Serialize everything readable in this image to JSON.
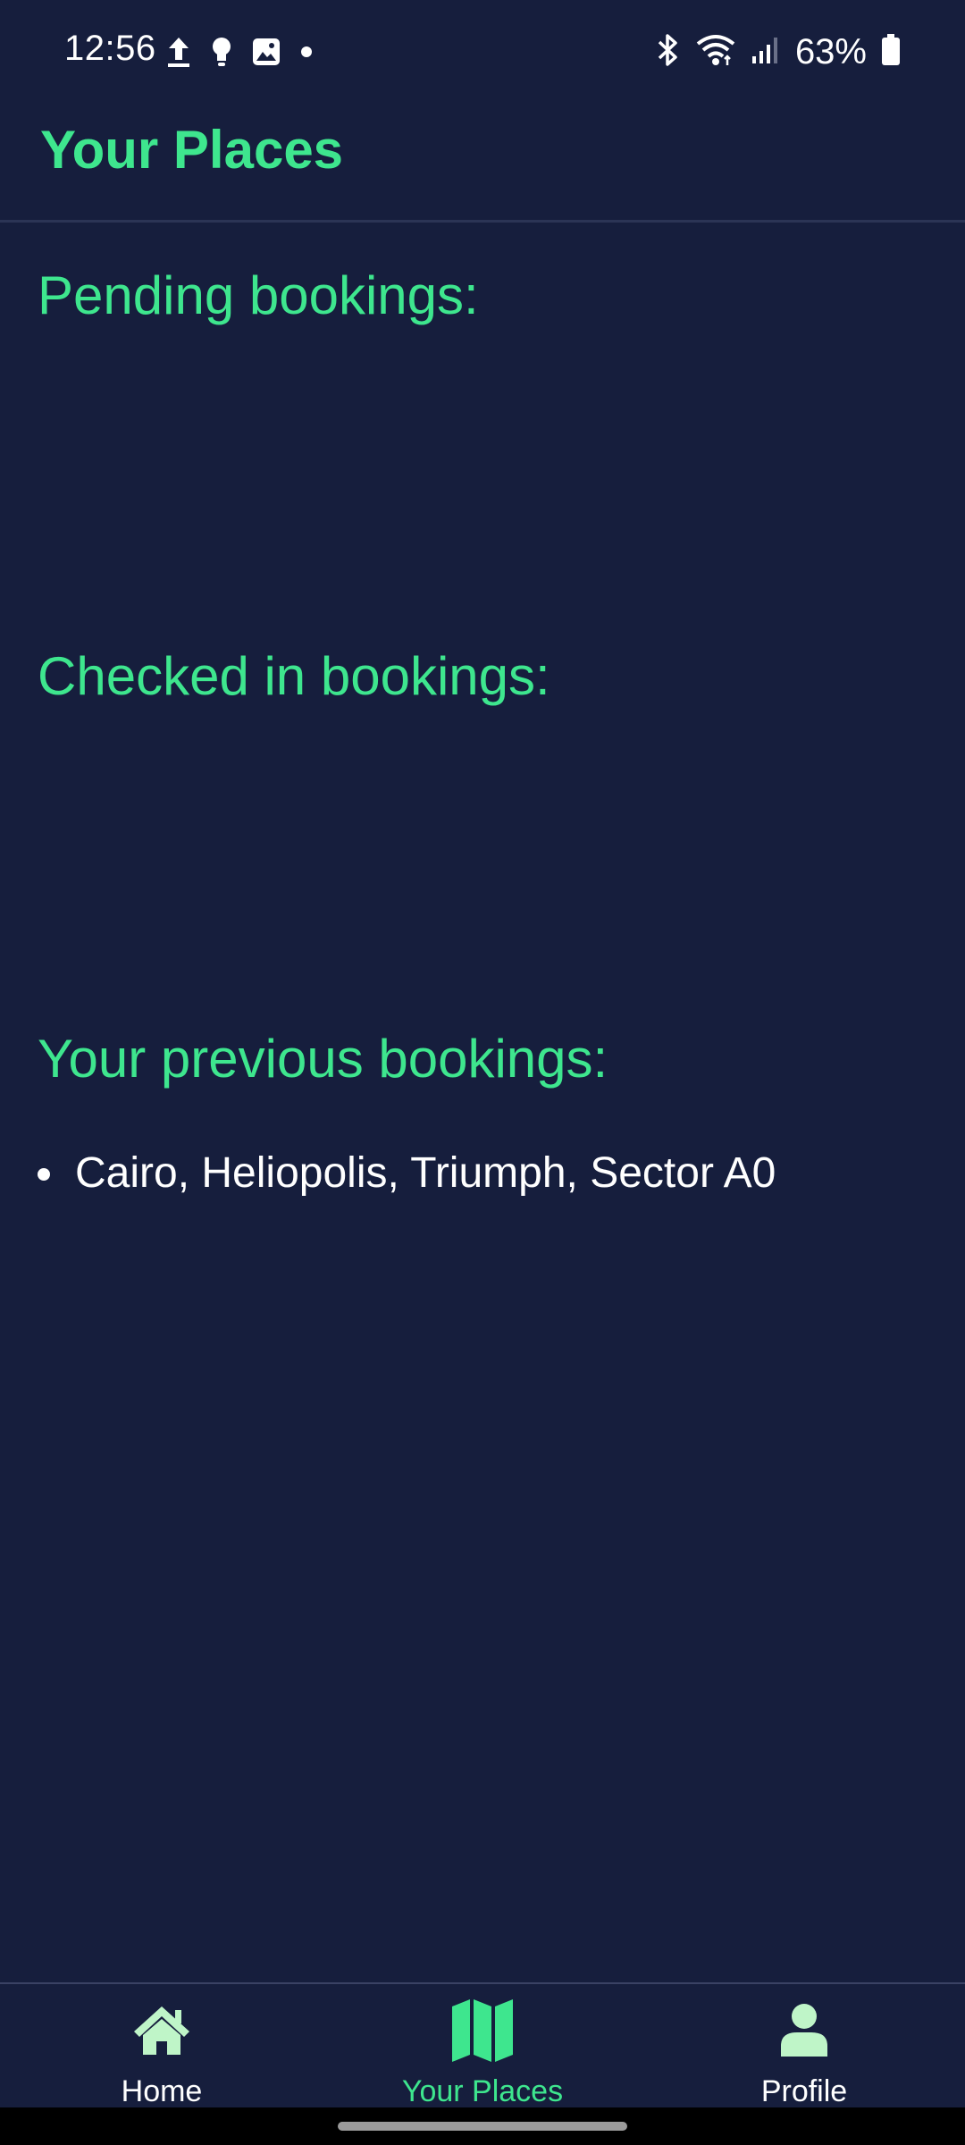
{
  "status_bar": {
    "time": "12:56",
    "battery_percent": "63%",
    "left_icons": [
      "upload-icon",
      "lightbulb-icon",
      "gallery-icon",
      "dot-icon"
    ],
    "right_icons": [
      "bluetooth-icon",
      "wifi-icon",
      "signal-icon",
      "battery-icon"
    ]
  },
  "app_bar": {
    "title": "Your Places"
  },
  "sections": {
    "pending_title": "Pending bookings:",
    "checked_in_title": "Checked in bookings:",
    "previous_title": "Your previous bookings:",
    "previous_bookings": [
      "Cairo, Heliopolis, Triumph, Sector A0"
    ]
  },
  "bottom_nav": {
    "items": [
      {
        "label": "Home",
        "icon": "home-icon",
        "active": false
      },
      {
        "label": "Your Places",
        "icon": "map-icon",
        "active": true
      },
      {
        "label": "Profile",
        "icon": "person-icon",
        "active": false
      }
    ]
  },
  "colors": {
    "background": "#161e3d",
    "accent": "#3ee68e",
    "nav_icon": "#bff5c8",
    "text": "#ffffff"
  }
}
